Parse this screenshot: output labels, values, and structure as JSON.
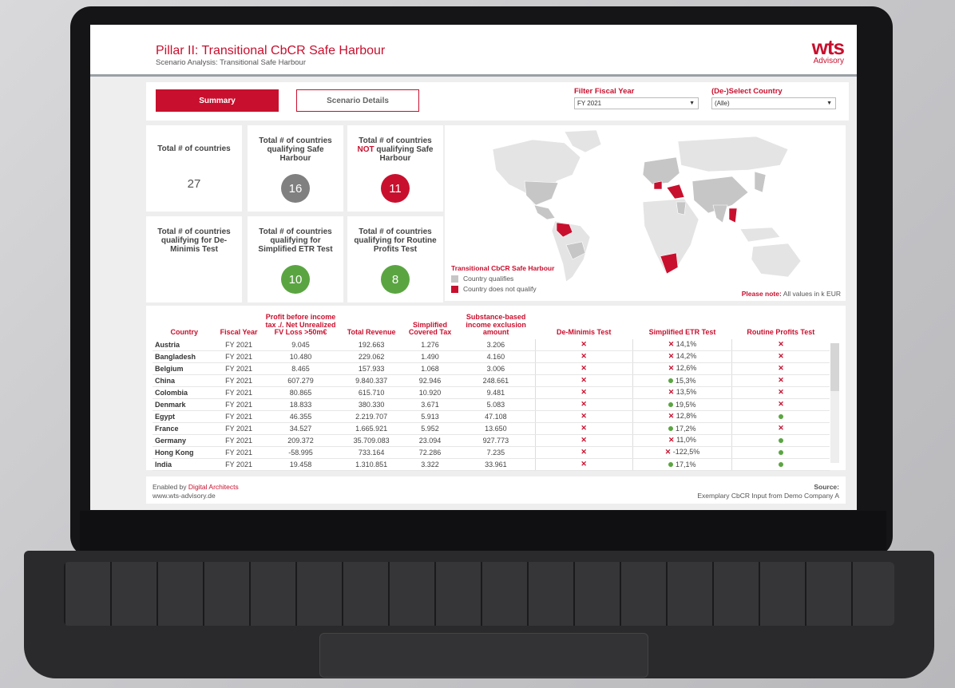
{
  "header": {
    "title": "Pillar II: Transitional CbCR Safe Harbour",
    "subtitle": "Scenario Analysis: Transitional Safe Harbour",
    "logo_main": "wts",
    "logo_sub": "Advisory"
  },
  "nav": {
    "summary": "Summary",
    "details": "Scenario Details"
  },
  "filters": {
    "fiscal_year": {
      "label": "Filter Fiscal Year",
      "value": "FY 2021"
    },
    "country": {
      "label": "(De-)Select Country",
      "value": "(Alle)"
    }
  },
  "kpis": {
    "total": {
      "label": "Total # of countries",
      "value": "27"
    },
    "qualifying": {
      "label": "Total # of countries qualifying Safe Harbour",
      "value": "16"
    },
    "not_qualifying": {
      "label_pre": "Total # of countries",
      "label_red": "NOT",
      "label_post": "qualifying Safe Harbour",
      "value": "11"
    },
    "deminimis": {
      "label": "Total # of countries qualifying for De-Minimis Test",
      "value": ""
    },
    "simplified_etr": {
      "label": "Total # of countries qualifying for Simplified ETR Test",
      "value": "10"
    },
    "routine_profits": {
      "label": "Total # of countries qualifying for Routine Profits Test",
      "value": "8"
    }
  },
  "map": {
    "legend_title": "Transitional CbCR Safe Harbour",
    "legend_items": [
      "Country qualifies",
      "Country does not qualify"
    ],
    "note_label": "Please note:",
    "note_text": "All values in k EUR",
    "colors": {
      "qualifies": "#c6c6c6",
      "not_qualify": "#c8102e",
      "other": "#e4e4e4"
    }
  },
  "table": {
    "headers": [
      "Country",
      "Fiscal Year",
      "Profit before income tax ./. Net Unrealized FV Loss >50m€",
      "Total Revenue",
      "Simplified Covered Tax",
      "Substance-based income exclusion amount",
      "De-Minimis Test",
      "Simplified ETR Test",
      "Routine Profits Test"
    ],
    "rows": [
      {
        "country": "Austria",
        "fy": "FY 2021",
        "pbt": "9.045",
        "rev": "192.663",
        "tax": "1.276",
        "sbie": "3.206",
        "dm": "fail",
        "etr": "fail",
        "etr_val": "14,1%",
        "rp": "fail"
      },
      {
        "country": "Bangladesh",
        "fy": "FY 2021",
        "pbt": "10.480",
        "rev": "229.062",
        "tax": "1.490",
        "sbie": "4.160",
        "dm": "fail",
        "etr": "fail",
        "etr_val": "14,2%",
        "rp": "fail"
      },
      {
        "country": "Belgium",
        "fy": "FY 2021",
        "pbt": "8.465",
        "rev": "157.933",
        "tax": "1.068",
        "sbie": "3.006",
        "dm": "fail",
        "etr": "fail",
        "etr_val": "12,6%",
        "rp": "fail"
      },
      {
        "country": "China",
        "fy": "FY 2021",
        "pbt": "607.279",
        "rev": "9.840.337",
        "tax": "92.946",
        "sbie": "248.661",
        "dm": "fail",
        "etr": "pass",
        "etr_val": "15,3%",
        "rp": "fail"
      },
      {
        "country": "Colombia",
        "fy": "FY 2021",
        "pbt": "80.865",
        "rev": "615.710",
        "tax": "10.920",
        "sbie": "9.481",
        "dm": "fail",
        "etr": "fail",
        "etr_val": "13,5%",
        "rp": "fail"
      },
      {
        "country": "Denmark",
        "fy": "FY 2021",
        "pbt": "18.833",
        "rev": "380.330",
        "tax": "3.671",
        "sbie": "5.083",
        "dm": "fail",
        "etr": "pass",
        "etr_val": "19,5%",
        "rp": "fail"
      },
      {
        "country": "Egypt",
        "fy": "FY 2021",
        "pbt": "46.355",
        "rev": "2.219.707",
        "tax": "5.913",
        "sbie": "47.108",
        "dm": "fail",
        "etr": "fail",
        "etr_val": "12,8%",
        "rp": "pass"
      },
      {
        "country": "France",
        "fy": "FY 2021",
        "pbt": "34.527",
        "rev": "1.665.921",
        "tax": "5.952",
        "sbie": "13.650",
        "dm": "fail",
        "etr": "pass",
        "etr_val": "17,2%",
        "rp": "fail"
      },
      {
        "country": "Germany",
        "fy": "FY 2021",
        "pbt": "209.372",
        "rev": "35.709.083",
        "tax": "23.094",
        "sbie": "927.773",
        "dm": "fail",
        "etr": "fail",
        "etr_val": "11,0%",
        "rp": "pass"
      },
      {
        "country": "Hong Kong",
        "fy": "FY 2021",
        "pbt": "-58.995",
        "rev": "733.164",
        "tax": "72.286",
        "sbie": "7.235",
        "dm": "fail",
        "etr": "fail",
        "etr_val": "-122,5%",
        "rp": "pass"
      },
      {
        "country": "India",
        "fy": "FY 2021",
        "pbt": "19.458",
        "rev": "1.310.851",
        "tax": "3.322",
        "sbie": "33.961",
        "dm": "fail",
        "etr": "pass",
        "etr_val": "17,1%",
        "rp": "pass"
      }
    ]
  },
  "footer": {
    "enabled_pre": "Enabled by",
    "enabled_link": "Digital Architects",
    "url": "www.wts-advisory.de",
    "source_label": "Source:",
    "source_text": "Exemplary CbCR Input from Demo Company A"
  }
}
